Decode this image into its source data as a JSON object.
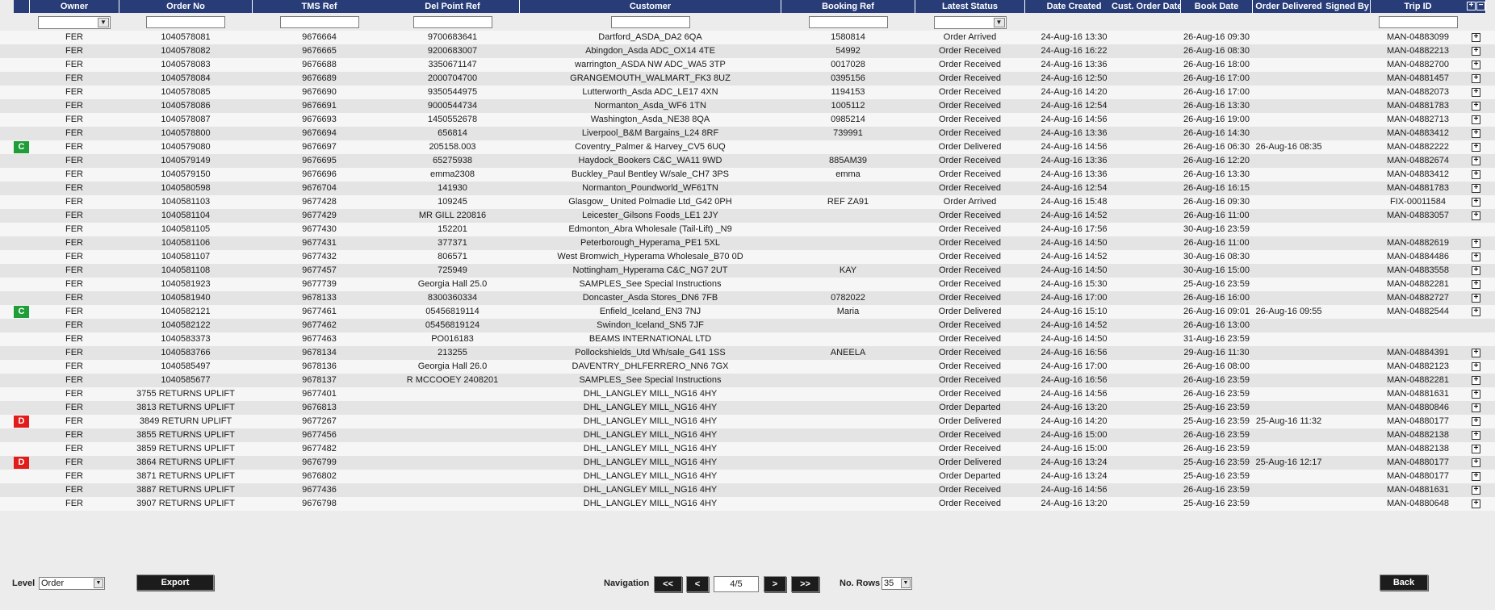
{
  "columns": [
    {
      "key": "owner",
      "label": "Owner",
      "filter": "select"
    },
    {
      "key": "order_no",
      "label": "Order No",
      "filter": "input"
    },
    {
      "key": "tms_ref",
      "label": "TMS Ref",
      "filter": "input"
    },
    {
      "key": "del_point_ref",
      "label": "Del Point Ref",
      "filter": "input"
    },
    {
      "key": "customer",
      "label": "Customer",
      "filter": "input"
    },
    {
      "key": "booking_ref",
      "label": "Booking Ref",
      "filter": "input"
    },
    {
      "key": "latest_status",
      "label": "Latest Status",
      "filter": "select"
    },
    {
      "key": "date_created",
      "label": "Date Created",
      "filter": "none"
    },
    {
      "key": "cust_order_date",
      "label": "Cust. Order Date",
      "filter": "none"
    },
    {
      "key": "book_date",
      "label": "Book Date",
      "filter": "none"
    },
    {
      "key": "order_delivered",
      "label": "Order Delivered",
      "filter": "none"
    },
    {
      "key": "signed_by",
      "label": "Signed By",
      "filter": "none"
    },
    {
      "key": "trip_id",
      "label": "Trip ID",
      "filter": "input"
    }
  ],
  "header_icons": [
    "expand-all-icon",
    "collapse-all-icon"
  ],
  "rows": [
    {
      "flag": "",
      "owner": "FER",
      "order_no": "1040578081",
      "tms_ref": "9676664",
      "del_point_ref": "9700683641",
      "customer": "Dartford_ASDA_DA2 6QA",
      "booking_ref": "1580814",
      "latest_status": "Order Arrived",
      "date_created": "24-Aug-16 13:30",
      "cust_order_date": "",
      "book_date": "26-Aug-16 09:30",
      "order_delivered": "",
      "signed_by": "",
      "trip_id": "MAN-04883099",
      "expand": true
    },
    {
      "flag": "",
      "owner": "FER",
      "order_no": "1040578082",
      "tms_ref": "9676665",
      "del_point_ref": "9200683007",
      "customer": "Abingdon_Asda ADC_OX14 4TE",
      "booking_ref": "54992",
      "latest_status": "Order Received",
      "date_created": "24-Aug-16 16:22",
      "cust_order_date": "",
      "book_date": "26-Aug-16 08:30",
      "order_delivered": "",
      "signed_by": "",
      "trip_id": "MAN-04882213",
      "expand": true
    },
    {
      "flag": "",
      "owner": "FER",
      "order_no": "1040578083",
      "tms_ref": "9676688",
      "del_point_ref": "3350671147",
      "customer": "warrington_ASDA NW ADC_WA5 3TP",
      "booking_ref": "0017028",
      "latest_status": "Order Received",
      "date_created": "24-Aug-16 13:36",
      "cust_order_date": "",
      "book_date": "26-Aug-16 18:00",
      "order_delivered": "",
      "signed_by": "",
      "trip_id": "MAN-04882700",
      "expand": true
    },
    {
      "flag": "",
      "owner": "FER",
      "order_no": "1040578084",
      "tms_ref": "9676689",
      "del_point_ref": "2000704700",
      "customer": "GRANGEMOUTH_WALMART_FK3 8UZ",
      "booking_ref": "0395156",
      "latest_status": "Order Received",
      "date_created": "24-Aug-16 12:50",
      "cust_order_date": "",
      "book_date": "26-Aug-16 17:00",
      "order_delivered": "",
      "signed_by": "",
      "trip_id": "MAN-04881457",
      "expand": true
    },
    {
      "flag": "",
      "owner": "FER",
      "order_no": "1040578085",
      "tms_ref": "9676690",
      "del_point_ref": "9350544975",
      "customer": "Lutterworth_Asda ADC_LE17 4XN",
      "booking_ref": "1194153",
      "latest_status": "Order Received",
      "date_created": "24-Aug-16 14:20",
      "cust_order_date": "",
      "book_date": "26-Aug-16 17:00",
      "order_delivered": "",
      "signed_by": "",
      "trip_id": "MAN-04882073",
      "expand": true
    },
    {
      "flag": "",
      "owner": "FER",
      "order_no": "1040578086",
      "tms_ref": "9676691",
      "del_point_ref": "9000544734",
      "customer": "Normanton_Asda_WF6 1TN",
      "booking_ref": "1005112",
      "latest_status": "Order Received",
      "date_created": "24-Aug-16 12:54",
      "cust_order_date": "",
      "book_date": "26-Aug-16 13:30",
      "order_delivered": "",
      "signed_by": "",
      "trip_id": "MAN-04881783",
      "expand": true
    },
    {
      "flag": "",
      "owner": "FER",
      "order_no": "1040578087",
      "tms_ref": "9676693",
      "del_point_ref": "1450552678",
      "customer": "Washington_Asda_NE38 8QA",
      "booking_ref": "0985214",
      "latest_status": "Order Received",
      "date_created": "24-Aug-16 14:56",
      "cust_order_date": "",
      "book_date": "26-Aug-16 19:00",
      "order_delivered": "",
      "signed_by": "",
      "trip_id": "MAN-04882713",
      "expand": true
    },
    {
      "flag": "",
      "owner": "FER",
      "order_no": "1040578800",
      "tms_ref": "9676694",
      "del_point_ref": "656814",
      "customer": "Liverpool_B&M Bargains_L24 8RF",
      "booking_ref": "739991",
      "latest_status": "Order Received",
      "date_created": "24-Aug-16 13:36",
      "cust_order_date": "",
      "book_date": "26-Aug-16 14:30",
      "order_delivered": "",
      "signed_by": "",
      "trip_id": "MAN-04883412",
      "expand": true
    },
    {
      "flag": "C",
      "owner": "FER",
      "order_no": "1040579080",
      "tms_ref": "9676697",
      "del_point_ref": "205158.003",
      "customer": "Coventry_Palmer & Harvey_CV5 6UQ",
      "booking_ref": "",
      "latest_status": "Order Delivered",
      "date_created": "24-Aug-16 14:56",
      "cust_order_date": "",
      "book_date": "26-Aug-16 06:30",
      "order_delivered": "26-Aug-16 08:35",
      "signed_by": "",
      "trip_id": "MAN-04882222",
      "expand": true
    },
    {
      "flag": "",
      "owner": "FER",
      "order_no": "1040579149",
      "tms_ref": "9676695",
      "del_point_ref": "65275938",
      "customer": "Haydock_Bookers C&C_WA11 9WD",
      "booking_ref": "885AM39",
      "latest_status": "Order Received",
      "date_created": "24-Aug-16 13:36",
      "cust_order_date": "",
      "book_date": "26-Aug-16 12:20",
      "order_delivered": "",
      "signed_by": "",
      "trip_id": "MAN-04882674",
      "expand": true
    },
    {
      "flag": "",
      "owner": "FER",
      "order_no": "1040579150",
      "tms_ref": "9676696",
      "del_point_ref": "emma2308",
      "customer": "Buckley_Paul Bentley W/sale_CH7 3PS",
      "booking_ref": "emma",
      "latest_status": "Order Received",
      "date_created": "24-Aug-16 13:36",
      "cust_order_date": "",
      "book_date": "26-Aug-16 13:30",
      "order_delivered": "",
      "signed_by": "",
      "trip_id": "MAN-04883412",
      "expand": true
    },
    {
      "flag": "",
      "owner": "FER",
      "order_no": "1040580598",
      "tms_ref": "9676704",
      "del_point_ref": "141930",
      "customer": "Normanton_Poundworld_WF61TN",
      "booking_ref": "",
      "latest_status": "Order Received",
      "date_created": "24-Aug-16 12:54",
      "cust_order_date": "",
      "book_date": "26-Aug-16 16:15",
      "order_delivered": "",
      "signed_by": "",
      "trip_id": "MAN-04881783",
      "expand": true
    },
    {
      "flag": "",
      "owner": "FER",
      "order_no": "1040581103",
      "tms_ref": "9677428",
      "del_point_ref": "109245",
      "customer": "Glasgow_ United Polmadie Ltd_G42 0PH",
      "booking_ref": "REF ZA91",
      "latest_status": "Order Arrived",
      "date_created": "24-Aug-16 15:48",
      "cust_order_date": "",
      "book_date": "26-Aug-16 09:30",
      "order_delivered": "",
      "signed_by": "",
      "trip_id": "FIX-00011584",
      "expand": true
    },
    {
      "flag": "",
      "owner": "FER",
      "order_no": "1040581104",
      "tms_ref": "9677429",
      "del_point_ref": "MR GILL 220816",
      "customer": "Leicester_Gilsons Foods_LE1 2JY",
      "booking_ref": "",
      "latest_status": "Order Received",
      "date_created": "24-Aug-16 14:52",
      "cust_order_date": "",
      "book_date": "26-Aug-16 11:00",
      "order_delivered": "",
      "signed_by": "",
      "trip_id": "MAN-04883057",
      "expand": true
    },
    {
      "flag": "",
      "owner": "FER",
      "order_no": "1040581105",
      "tms_ref": "9677430",
      "del_point_ref": "152201",
      "customer": "Edmonton_Abra Wholesale (Tail-Lift) _N9",
      "booking_ref": "",
      "latest_status": "Order Received",
      "date_created": "24-Aug-16 17:56",
      "cust_order_date": "",
      "book_date": "30-Aug-16 23:59",
      "order_delivered": "",
      "signed_by": "",
      "trip_id": "",
      "expand": false
    },
    {
      "flag": "",
      "owner": "FER",
      "order_no": "1040581106",
      "tms_ref": "9677431",
      "del_point_ref": "377371",
      "customer": "Peterborough_Hyperama_PE1 5XL",
      "booking_ref": "",
      "latest_status": "Order Received",
      "date_created": "24-Aug-16 14:50",
      "cust_order_date": "",
      "book_date": "26-Aug-16 11:00",
      "order_delivered": "",
      "signed_by": "",
      "trip_id": "MAN-04882619",
      "expand": true
    },
    {
      "flag": "",
      "owner": "FER",
      "order_no": "1040581107",
      "tms_ref": "9677432",
      "del_point_ref": "806571",
      "customer": "West Bromwich_Hyperama Wholesale_B70 0D",
      "booking_ref": "",
      "latest_status": "Order Received",
      "date_created": "24-Aug-16 14:52",
      "cust_order_date": "",
      "book_date": "30-Aug-16 08:30",
      "order_delivered": "",
      "signed_by": "",
      "trip_id": "MAN-04884486",
      "expand": true
    },
    {
      "flag": "",
      "owner": "FER",
      "order_no": "1040581108",
      "tms_ref": "9677457",
      "del_point_ref": "725949",
      "customer": "Nottingham_Hyperama C&C_NG7 2UT",
      "booking_ref": "KAY",
      "latest_status": "Order Received",
      "date_created": "24-Aug-16 14:50",
      "cust_order_date": "",
      "book_date": "30-Aug-16 15:00",
      "order_delivered": "",
      "signed_by": "",
      "trip_id": "MAN-04883558",
      "expand": true
    },
    {
      "flag": "",
      "owner": "FER",
      "order_no": "1040581923",
      "tms_ref": "9677739",
      "del_point_ref": "Georgia Hall 25.0",
      "customer": "SAMPLES_See Special Instructions",
      "booking_ref": "",
      "latest_status": "Order Received",
      "date_created": "24-Aug-16 15:30",
      "cust_order_date": "",
      "book_date": "25-Aug-16 23:59",
      "order_delivered": "",
      "signed_by": "",
      "trip_id": "MAN-04882281",
      "expand": true
    },
    {
      "flag": "",
      "owner": "FER",
      "order_no": "1040581940",
      "tms_ref": "9678133",
      "del_point_ref": "8300360334",
      "customer": "Doncaster_Asda Stores_DN6 7FB",
      "booking_ref": "0782022",
      "latest_status": "Order Received",
      "date_created": "24-Aug-16 17:00",
      "cust_order_date": "",
      "book_date": "26-Aug-16 16:00",
      "order_delivered": "",
      "signed_by": "",
      "trip_id": "MAN-04882727",
      "expand": true
    },
    {
      "flag": "C",
      "owner": "FER",
      "order_no": "1040582121",
      "tms_ref": "9677461",
      "del_point_ref": "05456819114",
      "customer": "Enfield_Iceland_EN3 7NJ",
      "booking_ref": "Maria",
      "latest_status": "Order Delivered",
      "date_created": "24-Aug-16 15:10",
      "cust_order_date": "",
      "book_date": "26-Aug-16 09:01",
      "order_delivered": "26-Aug-16 09:55",
      "signed_by": "",
      "trip_id": "MAN-04882544",
      "expand": true
    },
    {
      "flag": "",
      "owner": "FER",
      "order_no": "1040582122",
      "tms_ref": "9677462",
      "del_point_ref": "05456819124",
      "customer": "Swindon_Iceland_SN5 7JF",
      "booking_ref": "",
      "latest_status": "Order Received",
      "date_created": "24-Aug-16 14:52",
      "cust_order_date": "",
      "book_date": "26-Aug-16 13:00",
      "order_delivered": "",
      "signed_by": "",
      "trip_id": "",
      "expand": false
    },
    {
      "flag": "",
      "owner": "FER",
      "order_no": "1040583373",
      "tms_ref": "9677463",
      "del_point_ref": "PO016183",
      "customer": "BEAMS INTERNATIONAL LTD",
      "booking_ref": "",
      "latest_status": "Order Received",
      "date_created": "24-Aug-16 14:50",
      "cust_order_date": "",
      "book_date": "31-Aug-16 23:59",
      "order_delivered": "",
      "signed_by": "",
      "trip_id": "",
      "expand": false
    },
    {
      "flag": "",
      "owner": "FER",
      "order_no": "1040583766",
      "tms_ref": "9678134",
      "del_point_ref": "213255",
      "customer": "Pollockshields_Utd Wh/sale_G41 1SS",
      "booking_ref": "ANEELA",
      "latest_status": "Order Received",
      "date_created": "24-Aug-16 16:56",
      "cust_order_date": "",
      "book_date": "29-Aug-16 11:30",
      "order_delivered": "",
      "signed_by": "",
      "trip_id": "MAN-04884391",
      "expand": true
    },
    {
      "flag": "",
      "owner": "FER",
      "order_no": "1040585497",
      "tms_ref": "9678136",
      "del_point_ref": "Georgia Hall 26.0",
      "customer": "DAVENTRY_DHLFERRERO_NN6 7GX",
      "booking_ref": "",
      "latest_status": "Order Received",
      "date_created": "24-Aug-16 17:00",
      "cust_order_date": "",
      "book_date": "26-Aug-16 08:00",
      "order_delivered": "",
      "signed_by": "",
      "trip_id": "MAN-04882123",
      "expand": true
    },
    {
      "flag": "",
      "owner": "FER",
      "order_no": "1040585677",
      "tms_ref": "9678137",
      "del_point_ref": "R MCCOOEY 2408201",
      "customer": "SAMPLES_See Special Instructions",
      "booking_ref": "",
      "latest_status": "Order Received",
      "date_created": "24-Aug-16 16:56",
      "cust_order_date": "",
      "book_date": "26-Aug-16 23:59",
      "order_delivered": "",
      "signed_by": "",
      "trip_id": "MAN-04882281",
      "expand": true
    },
    {
      "flag": "",
      "owner": "FER",
      "order_no": "3755 RETURNS UPLIFT",
      "tms_ref": "9677401",
      "del_point_ref": "",
      "customer": "DHL_LANGLEY MILL_NG16 4HY",
      "booking_ref": "",
      "latest_status": "Order Received",
      "date_created": "24-Aug-16 14:56",
      "cust_order_date": "",
      "book_date": "26-Aug-16 23:59",
      "order_delivered": "",
      "signed_by": "",
      "trip_id": "MAN-04881631",
      "expand": true
    },
    {
      "flag": "",
      "owner": "FER",
      "order_no": "3813 RETURNS UPLIFT",
      "tms_ref": "9676813",
      "del_point_ref": "",
      "customer": "DHL_LANGLEY MILL_NG16 4HY",
      "booking_ref": "",
      "latest_status": "Order Departed",
      "date_created": "24-Aug-16 13:20",
      "cust_order_date": "",
      "book_date": "25-Aug-16 23:59",
      "order_delivered": "",
      "signed_by": "",
      "trip_id": "MAN-04880846",
      "expand": true
    },
    {
      "flag": "D",
      "owner": "FER",
      "order_no": "3849 RETURN UPLIFT",
      "tms_ref": "9677267",
      "del_point_ref": "",
      "customer": "DHL_LANGLEY MILL_NG16 4HY",
      "booking_ref": "",
      "latest_status": "Order Delivered",
      "date_created": "24-Aug-16 14:20",
      "cust_order_date": "",
      "book_date": "25-Aug-16 23:59",
      "order_delivered": "25-Aug-16 11:32",
      "signed_by": "",
      "trip_id": "MAN-04880177",
      "expand": true
    },
    {
      "flag": "",
      "owner": "FER",
      "order_no": "3855 RETURNS UPLIFT",
      "tms_ref": "9677456",
      "del_point_ref": "",
      "customer": "DHL_LANGLEY MILL_NG16 4HY",
      "booking_ref": "",
      "latest_status": "Order Received",
      "date_created": "24-Aug-16 15:00",
      "cust_order_date": "",
      "book_date": "26-Aug-16 23:59",
      "order_delivered": "",
      "signed_by": "",
      "trip_id": "MAN-04882138",
      "expand": true
    },
    {
      "flag": "",
      "owner": "FER",
      "order_no": "3859 RETURNS UPLIFT",
      "tms_ref": "9677482",
      "del_point_ref": "",
      "customer": "DHL_LANGLEY MILL_NG16 4HY",
      "booking_ref": "",
      "latest_status": "Order Received",
      "date_created": "24-Aug-16 15:00",
      "cust_order_date": "",
      "book_date": "26-Aug-16 23:59",
      "order_delivered": "",
      "signed_by": "",
      "trip_id": "MAN-04882138",
      "expand": true
    },
    {
      "flag": "D",
      "owner": "FER",
      "order_no": "3864 RETURNS UPLIFT",
      "tms_ref": "9676799",
      "del_point_ref": "",
      "customer": "DHL_LANGLEY MILL_NG16 4HY",
      "booking_ref": "",
      "latest_status": "Order Delivered",
      "date_created": "24-Aug-16 13:24",
      "cust_order_date": "",
      "book_date": "25-Aug-16 23:59",
      "order_delivered": "25-Aug-16 12:17",
      "signed_by": "",
      "trip_id": "MAN-04880177",
      "expand": true
    },
    {
      "flag": "",
      "owner": "FER",
      "order_no": "3871 RETURNS UPLIFT",
      "tms_ref": "9676802",
      "del_point_ref": "",
      "customer": "DHL_LANGLEY MILL_NG16 4HY",
      "booking_ref": "",
      "latest_status": "Order Departed",
      "date_created": "24-Aug-16 13:24",
      "cust_order_date": "",
      "book_date": "25-Aug-16 23:59",
      "order_delivered": "",
      "signed_by": "",
      "trip_id": "MAN-04880177",
      "expand": true
    },
    {
      "flag": "",
      "owner": "FER",
      "order_no": "3887 RETURNS UPLIFT",
      "tms_ref": "9677436",
      "del_point_ref": "",
      "customer": "DHL_LANGLEY MILL_NG16 4HY",
      "booking_ref": "",
      "latest_status": "Order Received",
      "date_created": "24-Aug-16 14:56",
      "cust_order_date": "",
      "book_date": "26-Aug-16 23:59",
      "order_delivered": "",
      "signed_by": "",
      "trip_id": "MAN-04881631",
      "expand": true
    },
    {
      "flag": "",
      "owner": "FER",
      "order_no": "3907 RETURNS UPLIFT",
      "tms_ref": "9676798",
      "del_point_ref": "",
      "customer": "DHL_LANGLEY MILL_NG16 4HY",
      "booking_ref": "",
      "latest_status": "Order Received",
      "date_created": "24-Aug-16 13:20",
      "cust_order_date": "",
      "book_date": "25-Aug-16 23:59",
      "order_delivered": "",
      "signed_by": "",
      "trip_id": "MAN-04880648",
      "expand": true
    }
  ],
  "footer": {
    "level_label": "Level",
    "level_value": "Order",
    "export_label": "Export",
    "navigation_label": "Navigation",
    "first_label": "<<",
    "prev_label": "<",
    "page_value": "4/5",
    "next_label": ">",
    "last_label": ">>",
    "rows_label": "No. Rows",
    "rows_value": "35",
    "back_label": "Back"
  },
  "colors": {
    "header_bg": "#283c78",
    "flag_c": "#1e9d38",
    "flag_d": "#e21b1b"
  }
}
